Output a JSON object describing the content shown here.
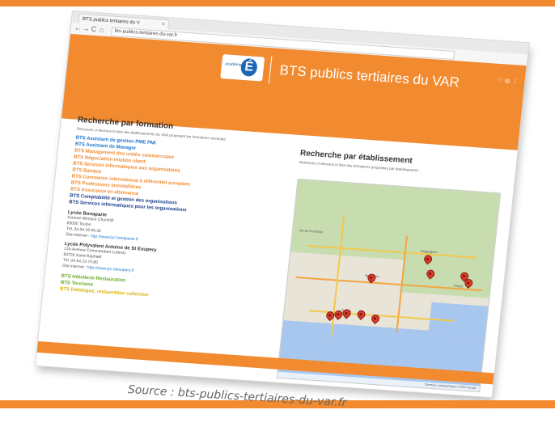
{
  "browser": {
    "tab_title": "BTS publics tertiaires du V",
    "tab_close": "×",
    "url": "bts-publics-tertiaires-du-var.fr",
    "nav": {
      "back": "←",
      "forward": "→",
      "reload": "C",
      "home": "⌂"
    }
  },
  "site": {
    "title": "BTS publics tertiaires du VAR",
    "logo_text": "académie Nice",
    "logo_letter": "É"
  },
  "left": {
    "title": "Recherche par formation",
    "intro": "Retrouvez ci-dessous la liste des établissements du VAR proposant les formations suivantes :",
    "links_blue": [
      "BTS Assistant de gestion PME PMI",
      "BTS Assistant de Manager"
    ],
    "links_orange": [
      "BTS Management des unités commerciales",
      "BTS Négociation relation client",
      "BTS Services informatiques aux organisations",
      "BTS Banque",
      "BTS Commerce international à référentiel européen",
      "BTS Professions immobilières",
      "BTS Assurance en alternance"
    ],
    "links_navy": [
      "BTS Comptabilité et gestion des organisations",
      "BTS Services informatiques pour les organisations"
    ],
    "school1": {
      "name": "Lycée Bonaparte",
      "lines": [
        "Avenue Winston Churchill",
        "83000 Toulon",
        "Tél. 04.94.18.95.30"
      ],
      "site_label": "Site internet :",
      "site_url": "http://www.lyc-bonaparte.fr"
    },
    "school2": {
      "name": "Lycée Polyvalent Antoine de St Exupery",
      "lines": [
        "12A Avenue Commandant Ludovic",
        "83700 Saint-Raphaël",
        "Tél. 04.94.19.79.80"
      ],
      "site_label": "Site internet :",
      "site_url": "http://www.lyc-stexupery.fr"
    },
    "links_green": [
      "BTS Hôtellerie-Restauration",
      "BTS Tourisme"
    ],
    "links_yellow": [
      "BTS Diététique, restauration collective"
    ]
  },
  "right": {
    "title": "Recherche par établissement",
    "intro": "Retrouvez ci-dessous la liste des formations proposées par établissement :",
    "map_labels": [
      "Toulon",
      "Draguignan",
      "Fréjus",
      "Brignoles",
      "Aix-en-Provence"
    ],
    "map_attribution": "Données cartographiques ©2015 Google"
  },
  "caption": "Source : bts-publics-tertiaires-du-var.fr",
  "colors": {
    "orange": "#f28a30",
    "blue": "#1c73d0",
    "navy": "#1a3e8a",
    "green": "#66aa22"
  }
}
